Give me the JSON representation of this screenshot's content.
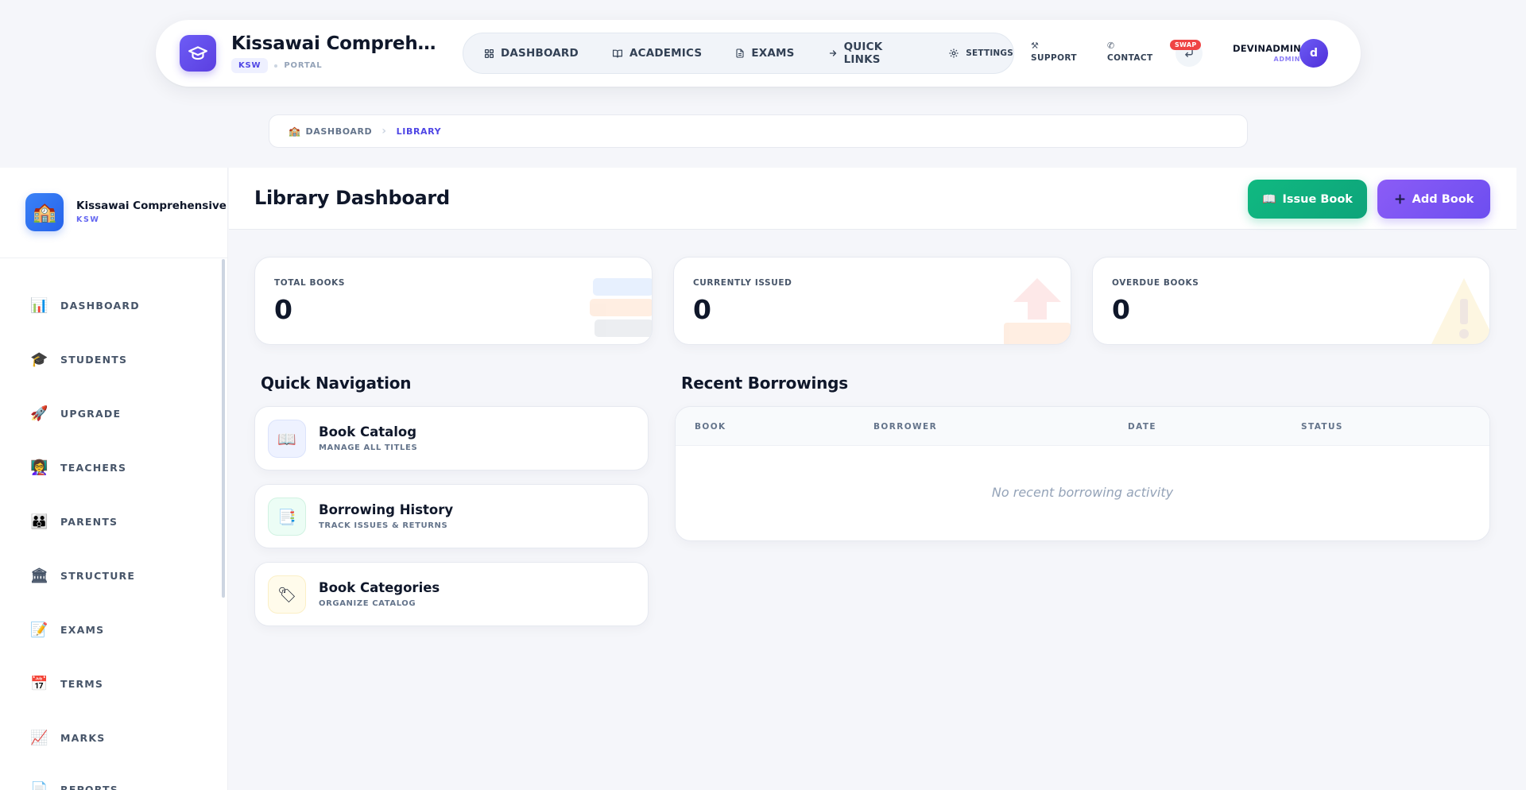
{
  "header": {
    "brand_title": "Kissawai Comprehensive",
    "brand_badge": "KSW",
    "brand_portal": "PORTAL",
    "nav": [
      {
        "label": "DASHBOARD"
      },
      {
        "label": "ACADEMICS"
      },
      {
        "label": "EXAMS"
      },
      {
        "label": "QUICK LINKS"
      },
      {
        "label": "SETTINGS"
      }
    ],
    "support_label": "SUPPORT",
    "contact_label": "CONTACT",
    "swap_badge": "SWAP",
    "user_name": "DEVINADMIN",
    "user_role": "ADMIN",
    "avatar_initial": "d"
  },
  "breadcrumb": {
    "home": "DASHBOARD",
    "current": "LIBRARY"
  },
  "sidebar": {
    "title": "Kissawai Comprehensive",
    "code": "KSW",
    "items": [
      {
        "label": "DASHBOARD",
        "icon": "📊"
      },
      {
        "label": "STUDENTS",
        "icon": "🎓"
      },
      {
        "label": "UPGRADE",
        "icon": "🚀"
      },
      {
        "label": "TEACHERS",
        "icon": "👩‍🏫"
      },
      {
        "label": "PARENTS",
        "icon": "👪"
      },
      {
        "label": "STRUCTURE",
        "icon": "🏛"
      },
      {
        "label": "EXAMS",
        "icon": "📝"
      },
      {
        "label": "TERMS",
        "icon": "📅"
      },
      {
        "label": "MARKS",
        "icon": "📈"
      },
      {
        "label": "REPORTS",
        "icon": "📄"
      }
    ]
  },
  "main": {
    "title": "Library Dashboard",
    "issue_button": "Issue Book",
    "add_button": "Add Book",
    "stats": [
      {
        "label": "TOTAL BOOKS",
        "value": "0"
      },
      {
        "label": "CURRENTLY ISSUED",
        "value": "0"
      },
      {
        "label": "OVERDUE BOOKS",
        "value": "0"
      }
    ],
    "quick_nav_title": "Quick Navigation",
    "quick_nav": [
      {
        "title": "Book Catalog",
        "subtitle": "MANAGE ALL TITLES"
      },
      {
        "title": "Borrowing History",
        "subtitle": "TRACK ISSUES & RETURNS"
      },
      {
        "title": "Book Categories",
        "subtitle": "ORGANIZE CATALOG"
      }
    ],
    "recent_title": "Recent Borrowings",
    "table_columns": [
      "BOOK",
      "BORROWER",
      "DATE",
      "STATUS"
    ],
    "empty_message": "No recent borrowing activity"
  },
  "colors": {
    "primary": "#5b3fe0",
    "success": "#10b981",
    "accent": "#8b5cf6",
    "danger": "#ef4444"
  },
  "icons": [
    "graduation-cap-icon",
    "grid-icon",
    "book-open-icon",
    "file-icon",
    "arrow-right-icon",
    "gear-icon",
    "hammer-icon",
    "phone-icon",
    "swap-icon",
    "school-icon",
    "chevron-right-icon",
    "book-icon",
    "plus-icon"
  ]
}
